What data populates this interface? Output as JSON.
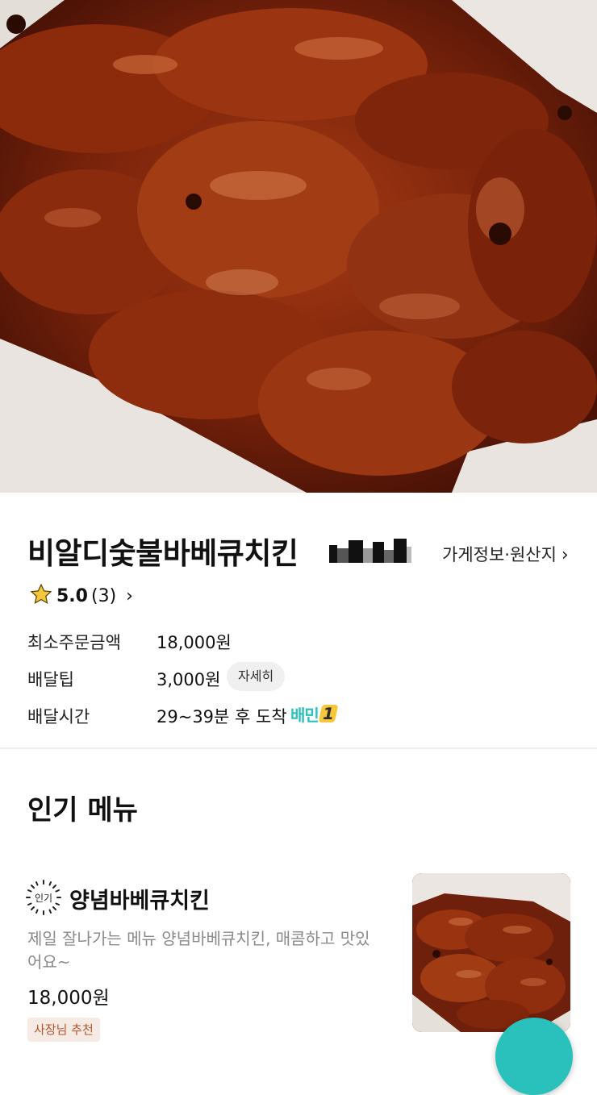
{
  "store": {
    "name": "비알디숯불바베큐치킨",
    "info_link": "가게정보·원산지",
    "rating_score": "5.0",
    "rating_count": "(3)"
  },
  "details": {
    "min_order_label": "최소주문금액",
    "min_order_value": "18,000원",
    "delivery_tip_label": "배달팁",
    "delivery_tip_value": "3,000원",
    "detail_button": "자세히",
    "delivery_time_label": "배달시간",
    "delivery_time_value": "29~39분 후 도착",
    "baemin_one_text": "배민",
    "baemin_one_num": "1"
  },
  "popular": {
    "section_title": "인기 메뉴",
    "badge_text": "인기",
    "item": {
      "name": "양념바베큐치킨",
      "description": "제일 잘나가는 메뉴 양념바베큐치킨, 매콤하고 맛있어요~",
      "price": "18,000원",
      "tag": "사장님 추천"
    }
  },
  "icons": {
    "info_chevron": "chevron-right-icon",
    "rating_star": "star-icon",
    "rating_chevron": "chevron-right-icon",
    "fab": "floating-action-button"
  },
  "colors": {
    "brand_mint": "#2ac1bc",
    "badge_yellow": "#f6c73a",
    "owner_tag_text": "#b5542c",
    "owner_tag_bg": "#f5ebe4"
  }
}
